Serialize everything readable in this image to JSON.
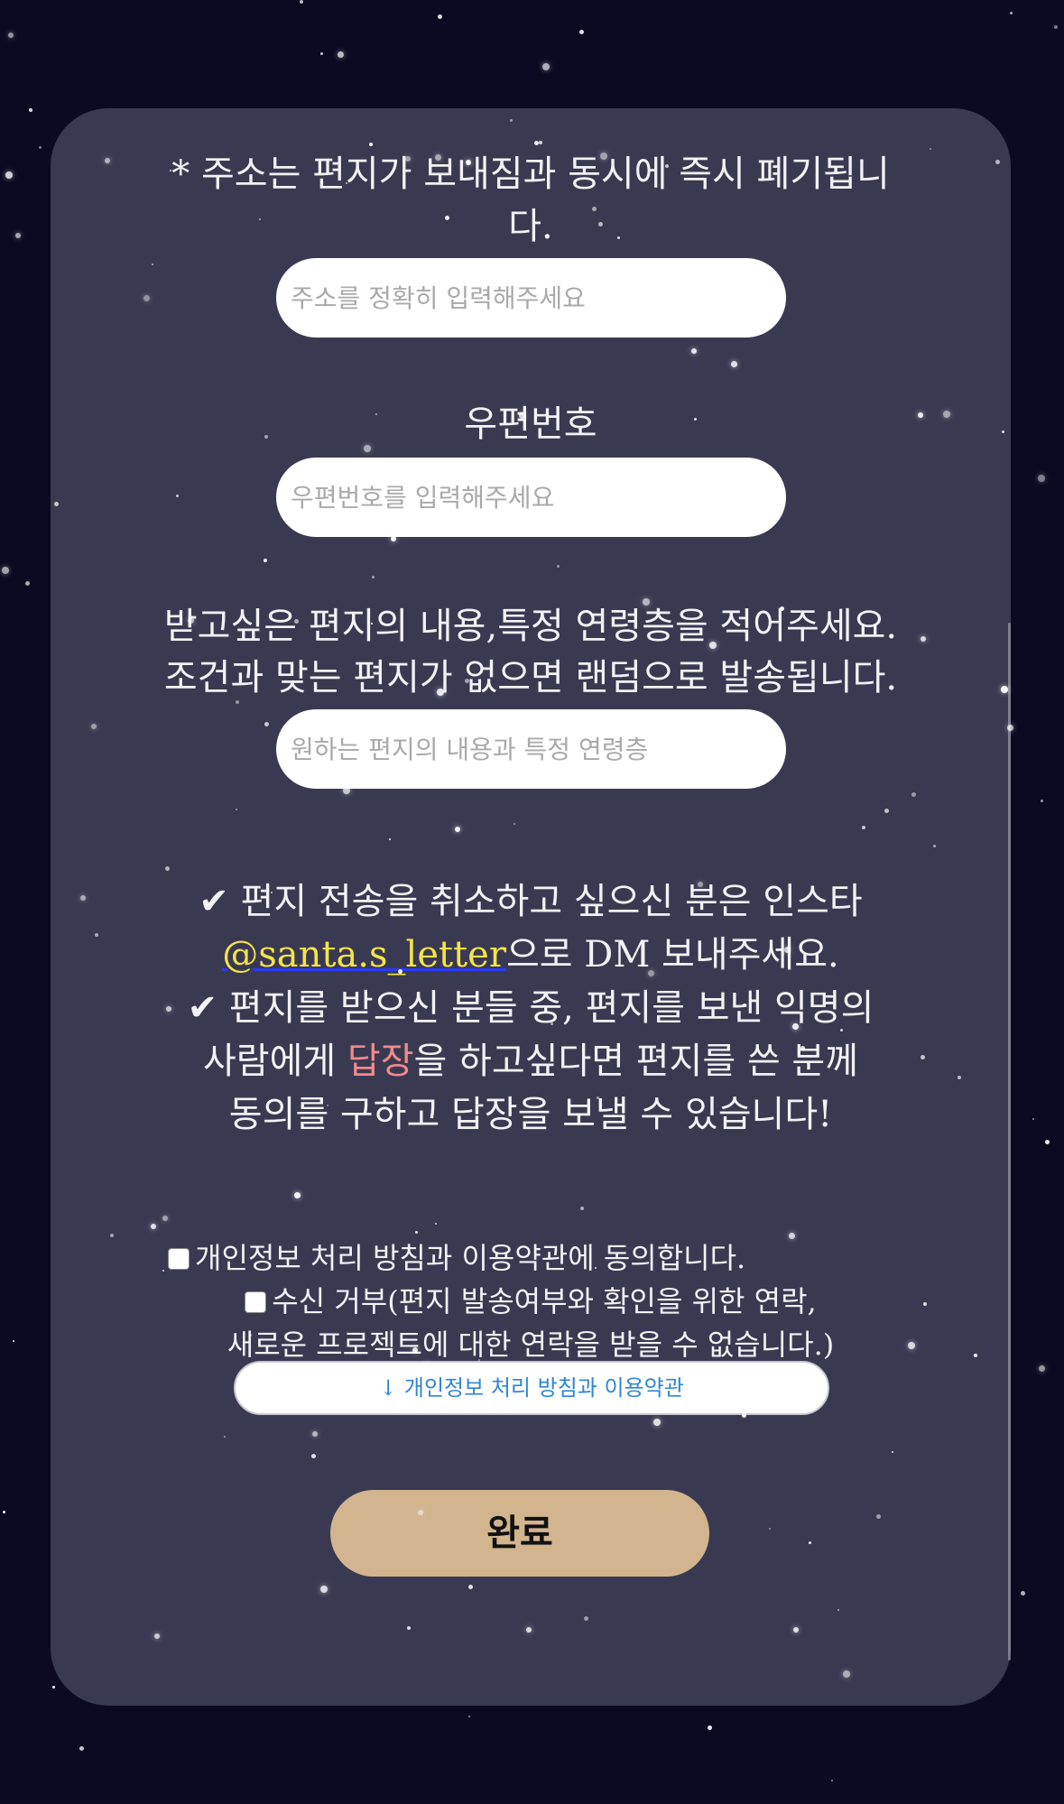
{
  "form": {
    "address_note": "* 주소는 편지가 보내짐과 동시에 즉시 폐기됩니다.",
    "address_placeholder": "주소를 정확히 입력해주세요",
    "postal_label": "우편번호",
    "postal_placeholder": "우편번호를 입력해주세요",
    "wish_label_line1": "받고싶은 편지의 내용,특정 연령층을 적어주세요.",
    "wish_label_line2": "조건과 맞는 편지가 없으면 랜덤으로 발송됩니다.",
    "wish_placeholder": "원하는 편지의 내용과 특정 연령층"
  },
  "notice": {
    "line1": "✔ 편지 전송을 취소하고 싶으신 분은 인스타",
    "handle": "@santa.s_letter",
    "line2_rest": "으로 DM 보내주세요.",
    "line3": "✔ 편지를 받으신 분들 중, 편지를 보낸 익명의",
    "line4_start": "사람에게 ",
    "reply_word": "답장",
    "line4_rest": "을 하고싶다면 편지를 쓴 분께",
    "line5": "동의를 구하고 답장을 보낼 수 있습니다!"
  },
  "consent": {
    "privacy_label": "개인정보 처리 방침과 이용약관에 동의합니다.",
    "optout_label_line1": "수신 거부(편지 발송여부와 확인을 위한 연락,",
    "optout_label_line2": "새로운 프로젝트에 대한 연락을 받을 수 없습니다.)"
  },
  "buttons": {
    "terms_link": "↓ 개인정보 처리 방침과 이용약관",
    "submit": "완료"
  },
  "colors": {
    "background": "#0b0a22",
    "card": "#393952",
    "handle": "#f2e44a",
    "reply_highlight": "#f08a8a",
    "link_blue": "#2f86d8",
    "submit_button": "#d2b48f"
  }
}
